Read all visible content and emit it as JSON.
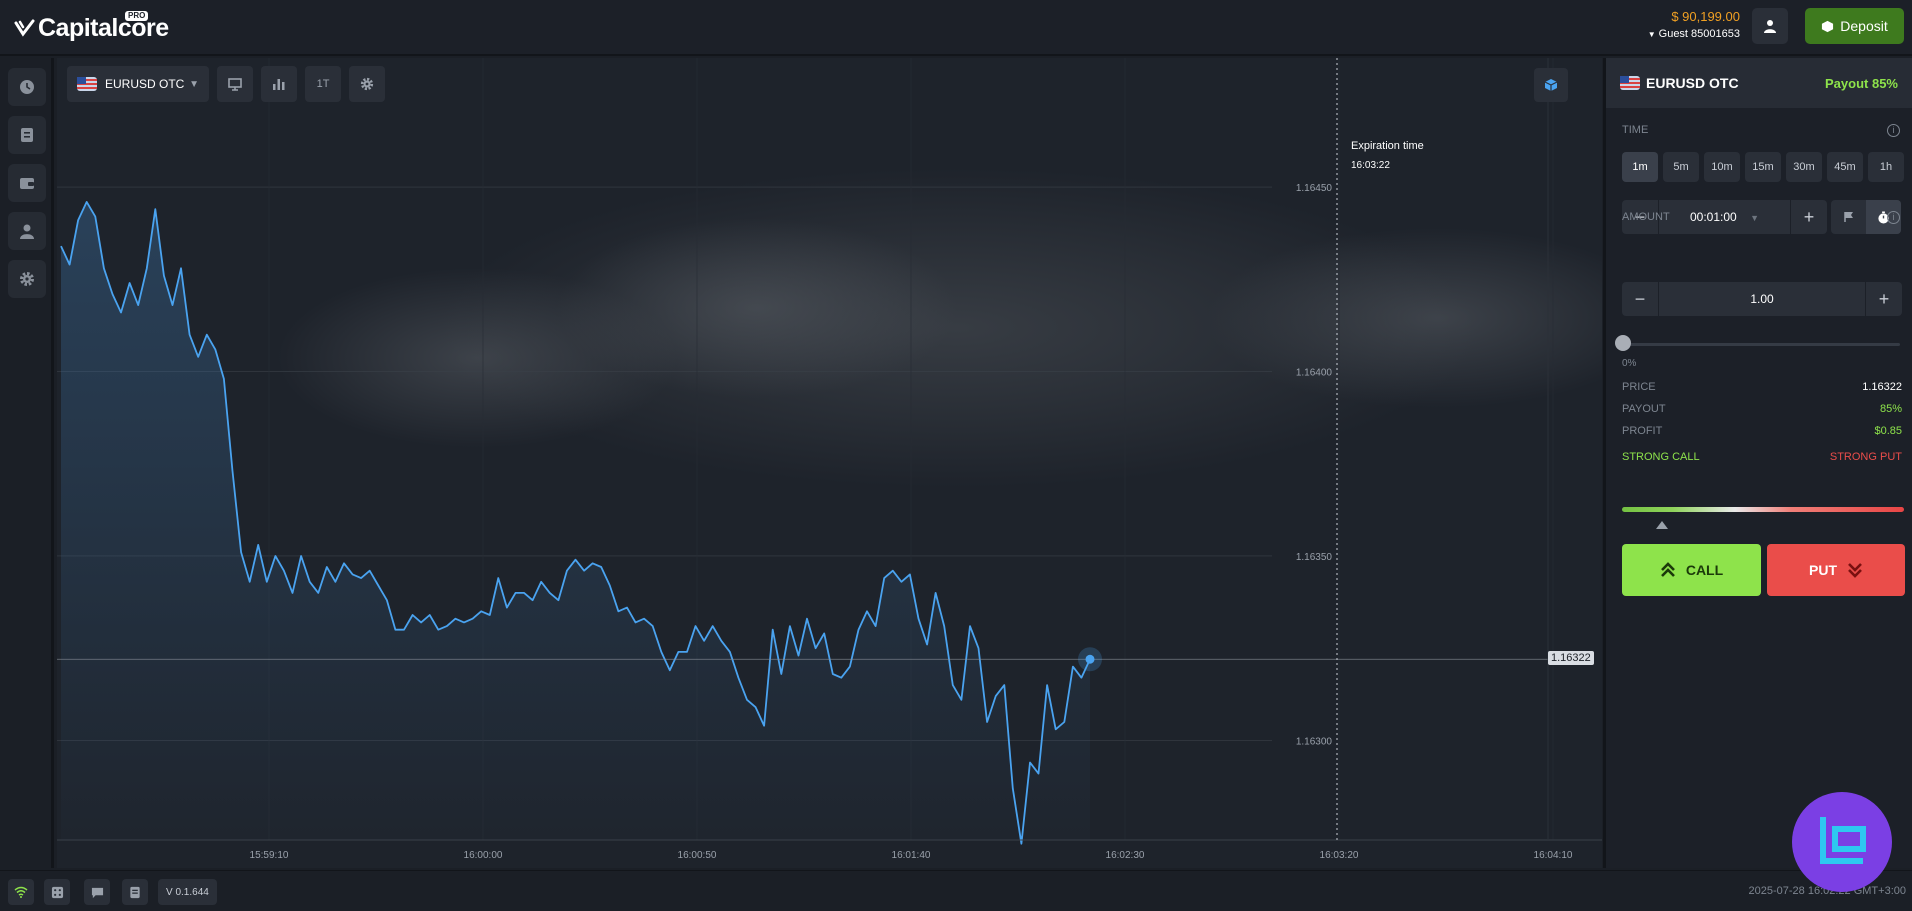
{
  "app": {
    "logo_text": "Capitalcore",
    "logo_badge": "PRO"
  },
  "header": {
    "balance": "$ 90,199.00",
    "account": "Guest 85001653",
    "deposit_label": "Deposit",
    "colors": {
      "balance": "#f0a023",
      "deposit": "#3e7a1e"
    }
  },
  "sidebar": {
    "items": [
      {
        "name": "history",
        "icon": "clock-icon"
      },
      {
        "name": "trades",
        "icon": "ticket-icon"
      },
      {
        "name": "wallet",
        "icon": "wallet-icon"
      },
      {
        "name": "profile",
        "icon": "user-icon"
      },
      {
        "name": "settings",
        "icon": "gear-icon"
      }
    ]
  },
  "chart_toolbar": {
    "pair": "EURUSD OTC",
    "timeframe": "1T",
    "tools": [
      "indicator-icon",
      "bar-chart-icon",
      "timeframe",
      "gear-icon"
    ]
  },
  "chart_data": {
    "type": "line",
    "series": [
      {
        "values": [
          1.16434,
          1.16429,
          1.16441,
          1.16446,
          1.16442,
          1.16428,
          1.16421,
          1.16416,
          1.16424,
          1.16418,
          1.16428,
          1.16444,
          1.16426,
          1.16418,
          1.16428,
          1.1641,
          1.16404,
          1.1641,
          1.16406,
          1.16398,
          1.16373,
          1.16351,
          1.16343,
          1.16353,
          1.16343,
          1.1635,
          1.16346,
          1.1634,
          1.1635,
          1.16343,
          1.1634,
          1.16347,
          1.16343,
          1.16348,
          1.16345,
          1.16344,
          1.16346,
          1.16342,
          1.16338,
          1.1633,
          1.1633,
          1.16334,
          1.16332,
          1.16334,
          1.1633,
          1.16331,
          1.16333,
          1.16332,
          1.16333,
          1.16335,
          1.16334,
          1.16344,
          1.16336,
          1.1634,
          1.1634,
          1.16338,
          1.16343,
          1.1634,
          1.16338,
          1.16346,
          1.16349,
          1.16346,
          1.16348,
          1.16347,
          1.16342,
          1.16335,
          1.16336,
          1.16332,
          1.16333,
          1.16331,
          1.16324,
          1.16319,
          1.16324,
          1.16324,
          1.16331,
          1.16327,
          1.16331,
          1.16327,
          1.16324,
          1.16317,
          1.16311,
          1.16309,
          1.16304,
          1.1633,
          1.16318,
          1.16331,
          1.16323,
          1.16333,
          1.16325,
          1.16329,
          1.16318,
          1.16317,
          1.1632,
          1.1633,
          1.16335,
          1.16331,
          1.16344,
          1.16346,
          1.16343,
          1.16345,
          1.16333,
          1.16326,
          1.1634,
          1.16331,
          1.16315,
          1.16311,
          1.16331,
          1.16325,
          1.16305,
          1.16312,
          1.16315,
          1.16287,
          1.16272,
          1.16294,
          1.16291,
          1.16315,
          1.16303,
          1.16305,
          1.1632,
          1.16317,
          1.16322
        ]
      }
    ],
    "x_tick_labels": [
      "15:59:10",
      "16:00:00",
      "16:00:50",
      "16:01:40",
      "16:02:30",
      "16:03:20",
      "16:04:10"
    ],
    "y_tick_labels": [
      "1.16450",
      "1.16400",
      "1.16350",
      "1.16300"
    ],
    "ylim": [
      1.16273,
      1.16485
    ],
    "current_price": "1.16322",
    "expiration_label": "Expiration time",
    "expiration_time": "16:03:22",
    "line_color": "#4aa3f0"
  },
  "trade_panel": {
    "pair": "EURUSD OTC",
    "payout_header": "Payout 85%",
    "time_label": "TIME",
    "time_options": [
      "1m",
      "5m",
      "10m",
      "15m",
      "30m",
      "45m",
      "1h"
    ],
    "time_selected": "1m",
    "duration": "00:01:00",
    "amount_label": "AMOUNT",
    "amount": "1.00",
    "slider_pct": "0%",
    "stats": [
      {
        "key": "PRICE",
        "value": "1.16322",
        "color": "#ffffff"
      },
      {
        "key": "PAYOUT",
        "value": "85%",
        "color": "#8ee34b"
      },
      {
        "key": "PROFIT",
        "value": "$0.85",
        "color": "#8ee34b"
      }
    ],
    "strong_call": "STRONG CALL",
    "strong_put": "STRONG PUT",
    "call_label": "CALL",
    "put_label": "PUT",
    "colors": {
      "call": "#8ee34b",
      "put": "#ea4d4a"
    }
  },
  "footer": {
    "version": "V 0.1.644",
    "datetime": "2025-07-28 16:02:22 GMT+3:00",
    "icons": [
      "wifi-icon",
      "dice-icon",
      "chat-icon",
      "document-icon"
    ]
  }
}
